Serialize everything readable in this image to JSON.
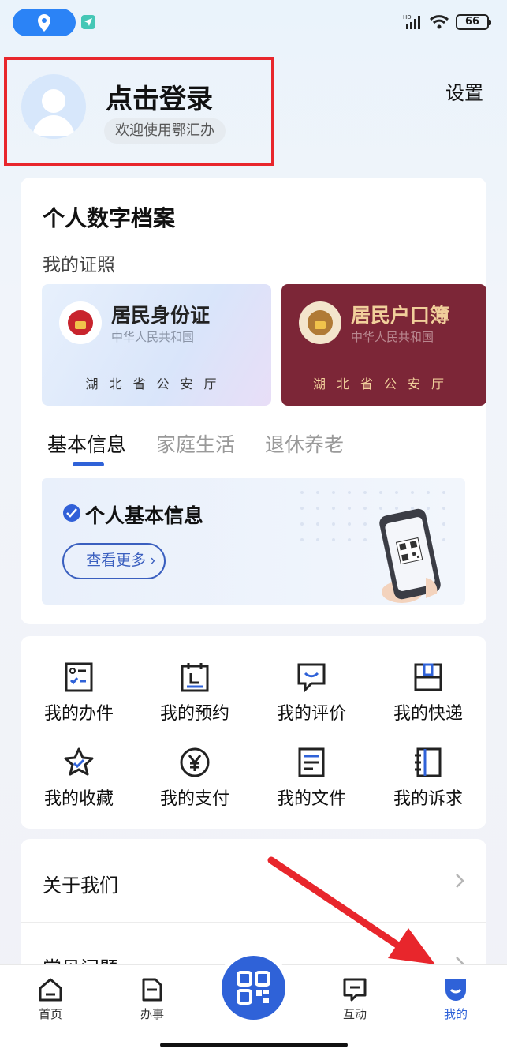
{
  "status_bar": {
    "battery": "66",
    "network": "HD"
  },
  "header": {
    "login_title": "点击登录",
    "welcome": "欢迎使用鄂汇办",
    "settings": "设置"
  },
  "profile": {
    "title": "个人数字档案",
    "licenses_title": "我的证照",
    "cards": [
      {
        "name": "居民身份证",
        "subtitle": "中华人民共和国",
        "issuer": "湖北省公安厅"
      },
      {
        "name": "居民户口簿",
        "subtitle": "中华人民共和国",
        "issuer": "湖北省公安厅"
      }
    ],
    "tabs": [
      "基本信息",
      "家庭生活",
      "退休养老"
    ],
    "active_tab": "基本信息",
    "info_title": "个人基本信息",
    "more_button": "查看更多"
  },
  "services": [
    {
      "label": "我的办件",
      "icon": "checklist-icon"
    },
    {
      "label": "我的预约",
      "icon": "calendar-icon"
    },
    {
      "label": "我的评价",
      "icon": "comment-icon"
    },
    {
      "label": "我的快递",
      "icon": "package-icon"
    },
    {
      "label": "我的收藏",
      "icon": "star-icon"
    },
    {
      "label": "我的支付",
      "icon": "yuan-icon"
    },
    {
      "label": "我的文件",
      "icon": "document-icon"
    },
    {
      "label": "我的诉求",
      "icon": "notebook-icon"
    }
  ],
  "list": [
    {
      "label": "关于我们"
    },
    {
      "label": "常见问题"
    }
  ],
  "bottom_nav": [
    {
      "label": "首页",
      "icon": "home-icon"
    },
    {
      "label": "办事",
      "icon": "file-icon"
    },
    {
      "label": "互动",
      "icon": "chat-icon"
    },
    {
      "label": "我的",
      "icon": "profile-icon",
      "active": true
    }
  ],
  "colors": {
    "accent": "#2f62d8",
    "highlight_box": "#e8262c",
    "hukou_card": "#7c2637"
  }
}
